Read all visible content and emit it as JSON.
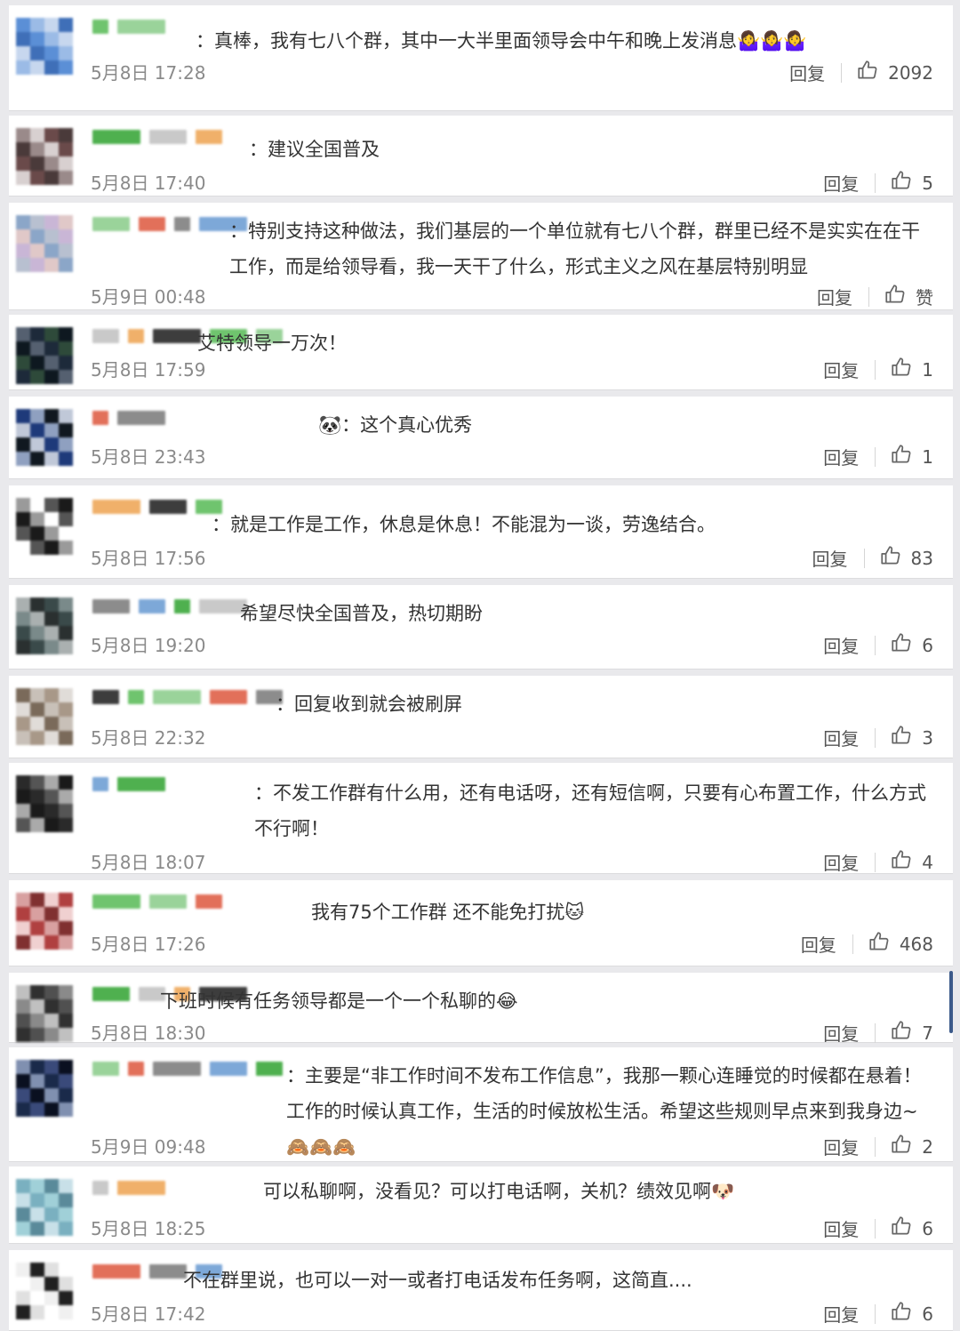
{
  "reply_label": "回复",
  "comments": [
    {
      "text": "：真棒，我有七八个群，其中一大半里面领导会中午和晚上发消息🤷‍♀️🤷‍♀️🤷‍♀️",
      "time": "5月8日 17:28",
      "likes": "2092"
    },
    {
      "text": "：建议全国普及",
      "time": "5月8日 17:40",
      "likes": "5"
    },
    {
      "text": "：特别支持这种做法，我们基层的一个单位就有七八个群，群里已经不是实实在在干工作，而是给领导看，我一天干了什么，形式主义之风在基层特别明显",
      "time": "5月9日 00:48",
      "likes": "赞"
    },
    {
      "text": "艾特领导一万次！",
      "time": "5月8日 17:59",
      "likes": "1"
    },
    {
      "text": "🐼：这个真心优秀",
      "time": "5月8日 23:43",
      "likes": "1"
    },
    {
      "text": "：就是工作是工作，休息是休息！不能混为一谈，劳逸结合。",
      "time": "5月8日 17:56",
      "likes": "83"
    },
    {
      "text": "希望尽快全国普及，热切期盼",
      "time": "5月8日 19:20",
      "likes": "6"
    },
    {
      "text": "：回复收到就会被刷屏",
      "time": "5月8日 22:32",
      "likes": "3"
    },
    {
      "text": "：不发工作群有什么用，还有电话呀，还有短信啊，只要有心布置工作，什么方式不行啊！",
      "time": "5月8日 18:07",
      "likes": "4"
    },
    {
      "text": "我有75个工作群 还不能免打扰🐱",
      "time": "5月8日 17:26",
      "likes": "468"
    },
    {
      "text": "下班时候有任务领导都是一个一个私聊的😂",
      "time": "5月8日 18:30",
      "likes": "7"
    },
    {
      "text": "：主要是“非工作时间不发布工作信息”，我那一颗心连睡觉的时候都在悬着！工作的时候认真工作，生活的时候放松生活。希望这些规则早点来到我身边~🙈🙈🙈",
      "time": "5月9日 09:48",
      "likes": "2"
    },
    {
      "text": "可以私聊啊，没看见？可以打电话啊，关机？绩效见啊🐶",
      "time": "5月8日 18:25",
      "likes": "6"
    },
    {
      "text": "不在群里说，也可以一对一或者打电话发布任务啊，这简直....",
      "time": "5月8日 17:42",
      "likes": "6"
    }
  ]
}
